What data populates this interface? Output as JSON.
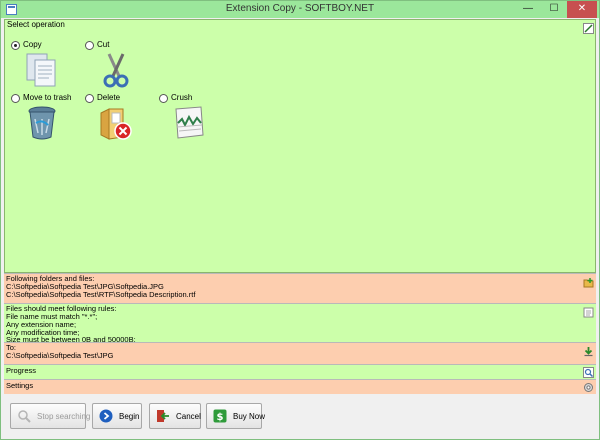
{
  "window": {
    "title": "Extension Copy  - SOFTBOY.NET"
  },
  "operations": {
    "label": "Select operation",
    "items": [
      {
        "label": "Copy",
        "checked": true
      },
      {
        "label": "Cut",
        "checked": false
      },
      {
        "label": "Move to trash",
        "checked": false
      },
      {
        "label": "Delete",
        "checked": false
      },
      {
        "label": "Crush",
        "checked": false
      }
    ]
  },
  "folders": {
    "heading": "Following folders and files:",
    "lines": [
      "C:\\Softpedia\\Softpedia Test\\JPG\\Softpedia.JPG",
      "C:\\Softpedia\\Softpedia Test\\RTF\\Softpedia Description.rtf"
    ]
  },
  "rules": {
    "heading": "Files should meet following rules:",
    "lines": [
      "File name must match \"*.*\";",
      "Any extension name;",
      "Any modification time;",
      "Size must be between 0B and 50000B;"
    ]
  },
  "destination": {
    "heading": "To:",
    "path": "C:\\Softpedia\\Softpedia Test\\JPG"
  },
  "progress": {
    "label": "Progress"
  },
  "settings": {
    "label": "Settings"
  },
  "buttons": {
    "stop": "Stop searching",
    "begin": "Begin",
    "cancel": "Cancel",
    "buy": "Buy Now"
  },
  "colors": {
    "titlebar": "#9be79b",
    "green_panel": "#ccffaa",
    "orange_panel": "#fdceaf",
    "close": "#c75050"
  },
  "icons": [
    "app-icon",
    "copy-icon",
    "scissors-icon",
    "trash-bin-icon",
    "delete-folder-icon",
    "crush-icon",
    "edit-icon",
    "add-folder-icon",
    "notepad-icon",
    "download-arrow-icon",
    "magnifier-icon",
    "gear-icon",
    "forward-arrow-icon",
    "cancel-arrow-icon",
    "dollar-icon"
  ]
}
